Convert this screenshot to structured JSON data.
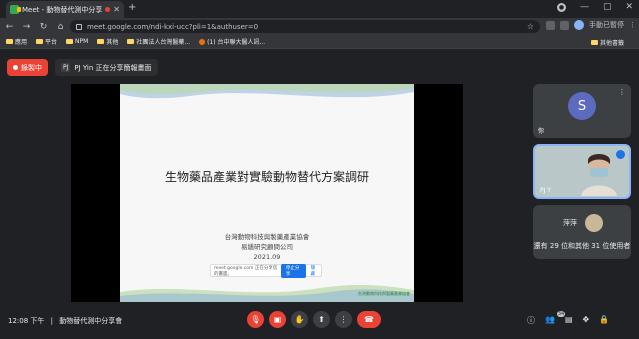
{
  "browser": {
    "tab_title": "Meet - 動物替代測中分享會",
    "new_tab": "+",
    "window_controls": [
      "—",
      "▢",
      "✕"
    ],
    "url": "meet.google.com/ndi-kxi-ucc?pli=1&authuser=0",
    "profile_label": "手動已暫停",
    "bookmarks": [
      "應用",
      "平台",
      "NPM",
      "其他",
      "社團法人台灣醫藥...",
      "(1) 台中聯大醫人訊..."
    ],
    "other_bookmarks": "其他書籤"
  },
  "meet": {
    "recording_label": "錄製中",
    "presenting_initials": "PJ",
    "presenting_label": "PJ Yin 正在分享簡報畫面",
    "slide": {
      "title": "生物藥品產業對實驗動物替代方案調研",
      "org_line1": "台灣動物科技與製藥產業協會",
      "org_line2": "易繕研究顧問公司",
      "date": "2021.09",
      "share_text": "meet.google.com 正在分享您的畫面。",
      "stop_label": "停止分享",
      "hide_label": "隱藏",
      "footer": "台灣動物科技與製藥產業協會"
    },
    "participants": {
      "tile1_initial": "S",
      "tile1_name": "你",
      "tile2_name": "PJ Y",
      "tile3_name": "萍萍",
      "tile3_more": "還有 29 位和其他 31 位使用者"
    },
    "bottom": {
      "time": "12:08 下午",
      "separator": "|",
      "meeting_name": "動物替代測中分享會",
      "participant_count": "34"
    },
    "icons": {
      "mic": "mic-off-icon",
      "cam": "camera-off-icon",
      "hand": "raise-hand-icon",
      "present": "present-icon",
      "more": "more-icon",
      "end": "end-call-icon"
    }
  }
}
